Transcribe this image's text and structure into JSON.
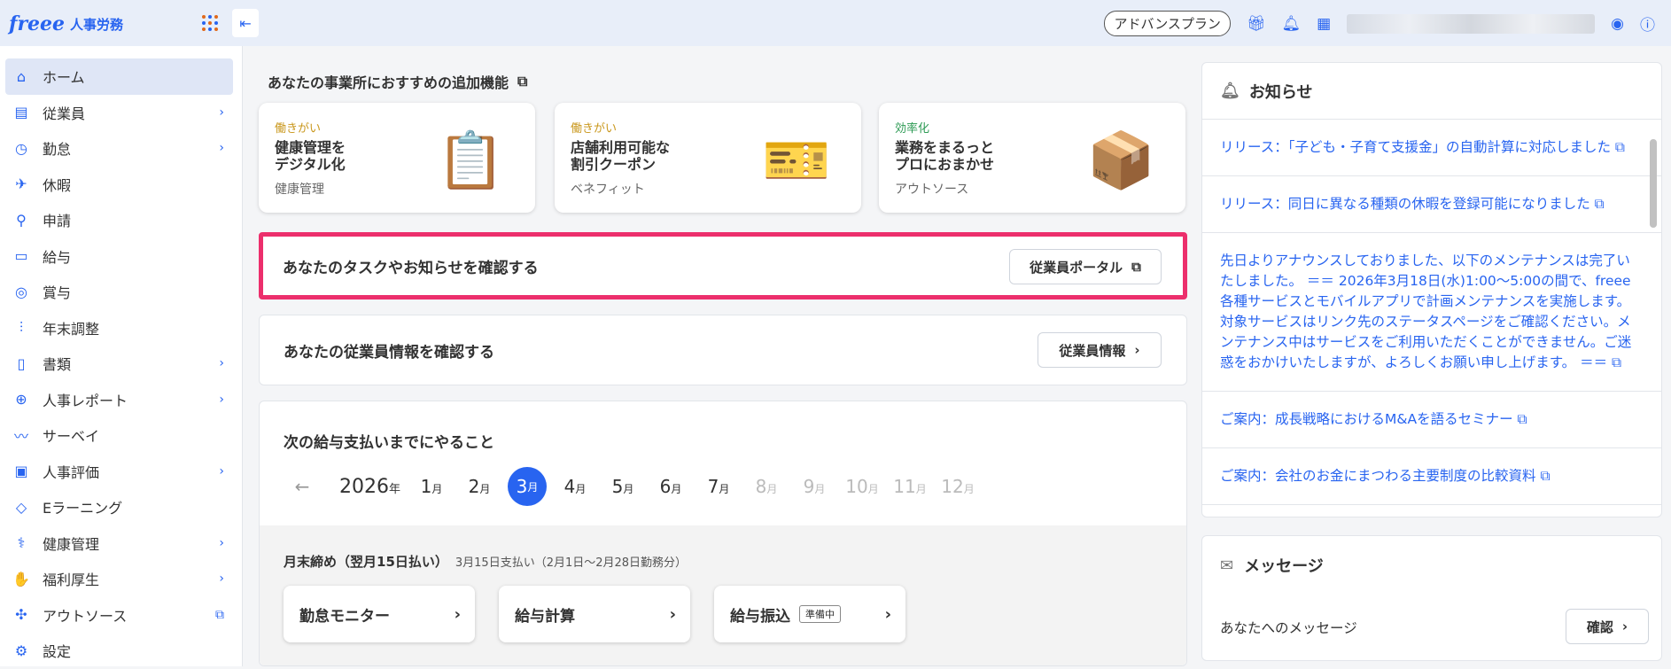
{
  "header": {
    "brand": "freee",
    "product": "人事労務",
    "plan": "アドバンスプラン"
  },
  "sidebar": {
    "items": [
      {
        "label": "ホーム",
        "icon": "shop-icon",
        "chev": "",
        "active": true
      },
      {
        "label": "従業員",
        "icon": "id-card-icon",
        "chev": "›"
      },
      {
        "label": "勤怠",
        "icon": "clock-icon",
        "chev": "›"
      },
      {
        "label": "休暇",
        "icon": "plane-icon",
        "chev": ""
      },
      {
        "label": "申請",
        "icon": "stamp-icon",
        "chev": ""
      },
      {
        "label": "給与",
        "icon": "wallet-icon",
        "chev": ""
      },
      {
        "label": "賞与",
        "icon": "medal-icon",
        "chev": ""
      },
      {
        "label": "年末調整",
        "icon": "sliders-icon",
        "chev": ""
      },
      {
        "label": "書類",
        "icon": "document-icon",
        "chev": "›"
      },
      {
        "label": "人事レポート",
        "icon": "analytics-icon",
        "chev": "›"
      },
      {
        "label": "サーベイ",
        "icon": "survey-icon",
        "chev": ""
      },
      {
        "label": "人事評価",
        "icon": "clipboard-icon",
        "chev": "›"
      },
      {
        "label": "Eラーニング",
        "icon": "graduation-icon",
        "chev": ""
      },
      {
        "label": "健康管理",
        "icon": "stethoscope-icon",
        "chev": "›"
      },
      {
        "label": "福利厚生",
        "icon": "hand-icon",
        "chev": "›"
      },
      {
        "label": "アウトソース",
        "icon": "network-icon",
        "chev": "⧉"
      },
      {
        "label": "設定",
        "icon": "gear-icon",
        "chev": ""
      }
    ]
  },
  "main": {
    "recommend_title": "あなたの事業所におすすめの追加機能",
    "cards": [
      {
        "cat": "働きがい",
        "title": "健康管理を\nデジタル化",
        "sub": "健康管理",
        "cat_color": "#c9971c",
        "icon": "clipboard-list-icon",
        "glyph": "📋"
      },
      {
        "cat": "働きがい",
        "title": "店舗利用可能な\n割引クーポン",
        "sub": "ベネフィット",
        "cat_color": "#c9971c",
        "icon": "ticket-icon",
        "glyph": "🎫"
      },
      {
        "cat": "効率化",
        "title": "業務をまるっと\nプロにおまかせ",
        "sub": "アウトソース",
        "cat_color": "#2e9b55",
        "icon": "box-icon",
        "glyph": "📦"
      }
    ],
    "task_text": "あなたのタスクやお知らせを確認する",
    "portal_btn": "従業員ポータル",
    "emp_text": "あなたの従業員情報を確認する",
    "emp_btn": "従業員情報",
    "pay_title": "次の給与支払いまでにやること",
    "year": "2026",
    "year_unit": "年",
    "month_unit": "月",
    "months": [
      "1",
      "2",
      "3",
      "4",
      "5",
      "6",
      "7",
      "8",
      "9",
      "10",
      "11",
      "12"
    ],
    "selected_month": "3",
    "close_label": "月末締め（翌月15日払い）",
    "close_sub": "3月15日支払い（2月1日〜2月28日勤務分）",
    "actions": [
      {
        "label": "勤怠モニター",
        "tag": ""
      },
      {
        "label": "給与計算",
        "tag": ""
      },
      {
        "label": "給与振込",
        "tag": "準備中"
      }
    ]
  },
  "notice": {
    "title": "お知らせ",
    "items": [
      "リリース：「子ども・子育て支援金」の自動計算に対応しました",
      "リリース：同日に異なる種類の休暇を登録可能になりました",
      "先日よりアナウンスしておりました、以下のメンテナンスは完了いたしました。 ＝＝ 2026年3月18日(水)1:00〜5:00の間で、freee各種サービスとモバイルアプリで計画メンテナンスを実施します。対象サービスはリンク先のステータスページをご確認ください。メンテナンス中はサービスをご利用いただくことができません。ご迷惑をおかけいたしますが、よろしくお願い申し上げます。 ＝＝",
      "ご案内：成長戦略におけるM&Aを語るセミナー",
      "ご案内：会社のお金にまつわる主要制度の比較資料"
    ]
  },
  "message": {
    "title": "メッセージ",
    "text": "あなたへのメッセージ",
    "btn": "確認"
  }
}
